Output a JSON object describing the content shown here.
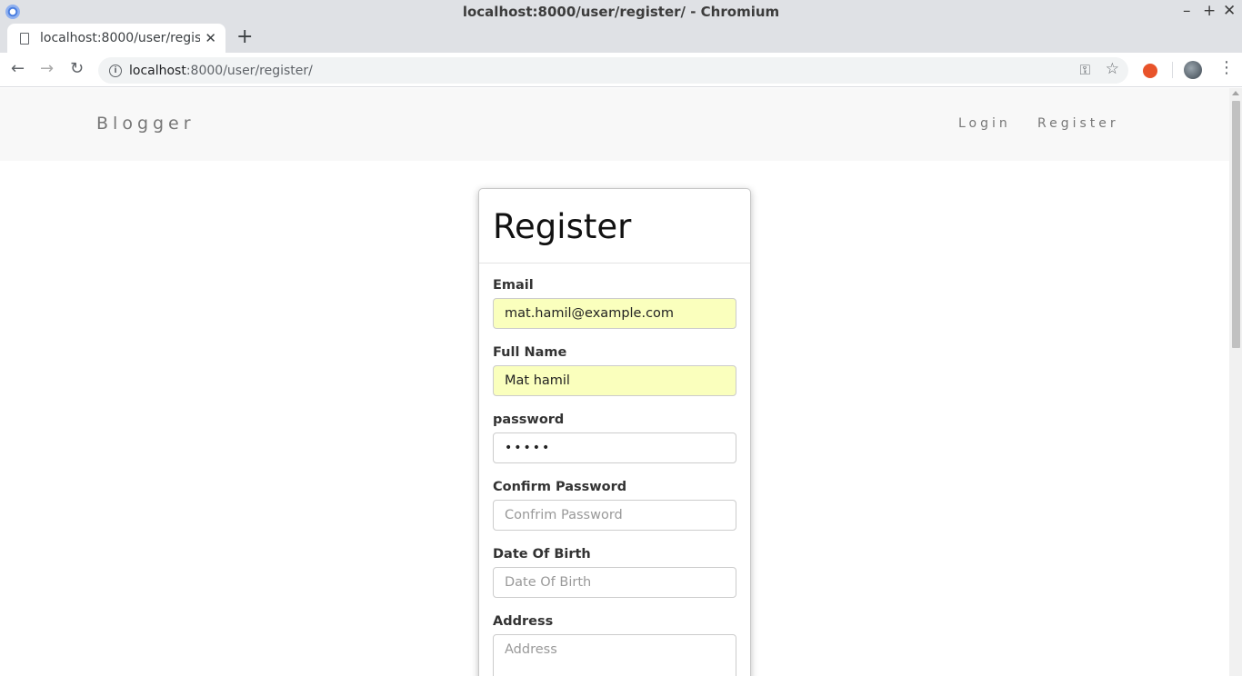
{
  "window": {
    "title": "localhost:8000/user/register/ - Chromium"
  },
  "tab": {
    "title": "localhost:8000/user/register/"
  },
  "address_bar": {
    "host": "localhost",
    "path": ":8000/user/register/"
  },
  "site": {
    "brand": "Blogger",
    "nav": {
      "login": "Login",
      "register": "Register"
    }
  },
  "form": {
    "heading": "Register",
    "email": {
      "label": "Email",
      "value": "mat.hamil@example.com"
    },
    "full_name": {
      "label": "Full Name",
      "value": "Mat hamil"
    },
    "password": {
      "label": "password",
      "value": "•••••"
    },
    "confirm_password": {
      "label": "Confirm Password",
      "placeholder": "Confrim Password"
    },
    "dob": {
      "label": "Date Of Birth",
      "placeholder": "Date Of Birth"
    },
    "address": {
      "label": "Address",
      "placeholder": "Address"
    }
  },
  "colors": {
    "autofill": "#faffbd",
    "navbar_bg": "#f8f8f8"
  }
}
